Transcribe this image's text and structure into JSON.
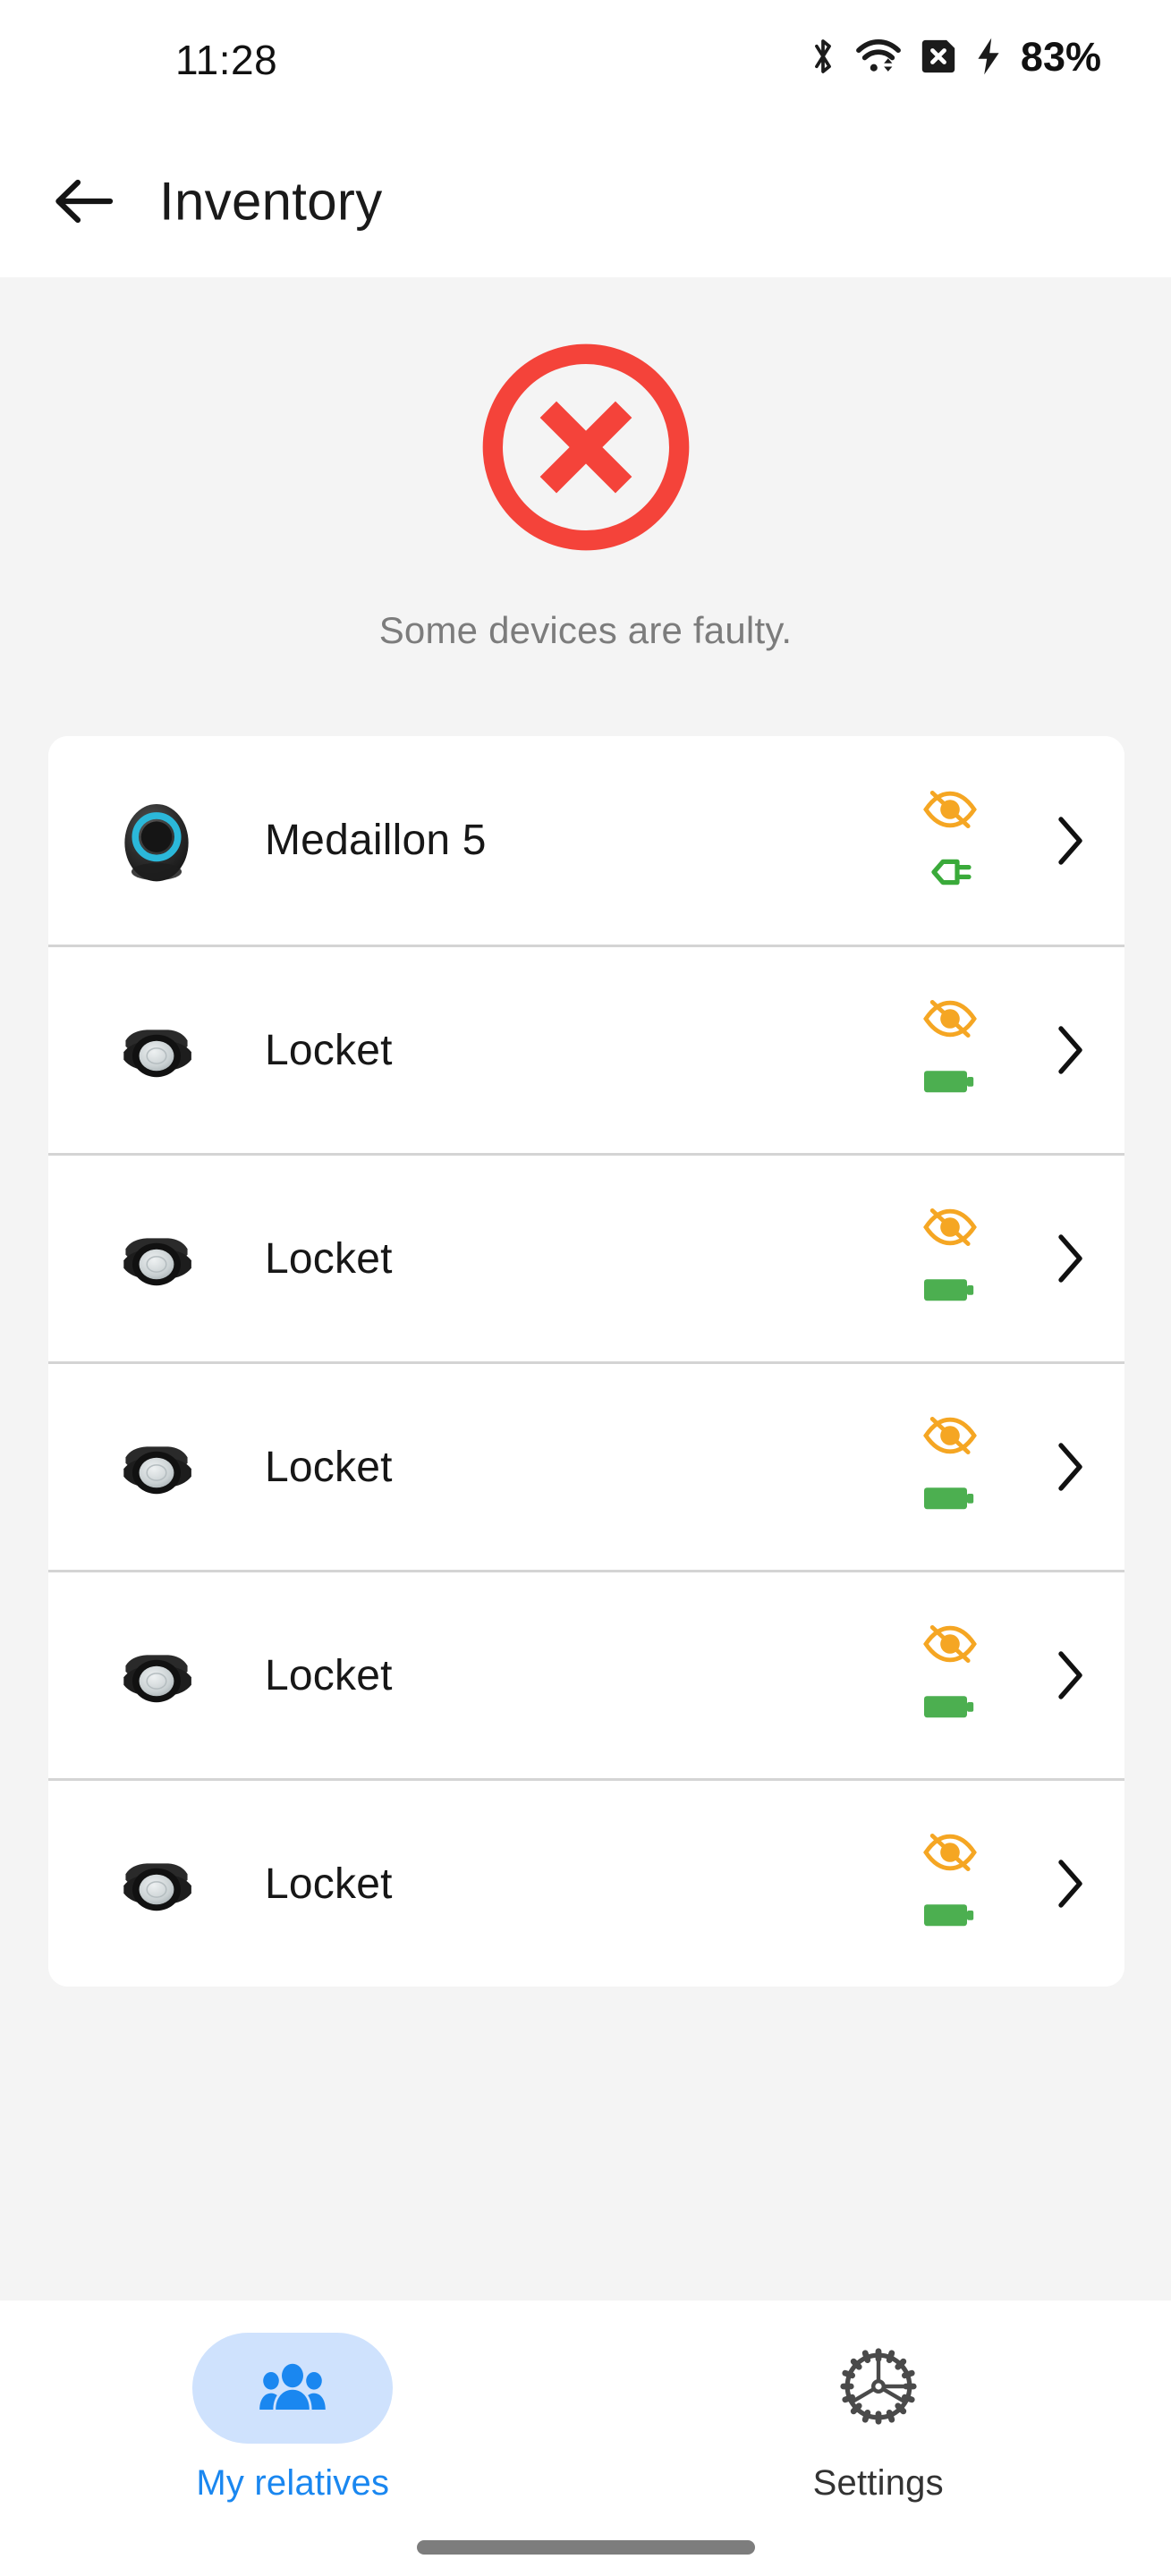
{
  "statusbar": {
    "time": "11:28",
    "battery_percent": "83%",
    "icons": [
      "bluetooth-icon",
      "wifi-icon",
      "sim-card-off-icon",
      "charging-bolt-icon"
    ]
  },
  "appbar": {
    "back_label": "back-arrow-icon",
    "title": "Inventory"
  },
  "status": {
    "icon": "error-circle-x-icon",
    "icon_color": "#F44336",
    "message": "Some devices are faulty."
  },
  "devices": [
    {
      "name": "Medaillon 5",
      "thumb": "medaillon-device-icon",
      "visibility": "visibility-off-icon",
      "visibility_color": "#F5A623",
      "power": "power-plug-icon",
      "power_color": "#3AAA3A",
      "chevron": "chevron-right-icon"
    },
    {
      "name": "Locket",
      "thumb": "locket-device-icon",
      "visibility": "visibility-off-icon",
      "visibility_color": "#F5A623",
      "power": "battery-full-icon",
      "power_color": "#4CAF50",
      "chevron": "chevron-right-icon"
    },
    {
      "name": "Locket",
      "thumb": "locket-device-icon",
      "visibility": "visibility-off-icon",
      "visibility_color": "#F5A623",
      "power": "battery-full-icon",
      "power_color": "#4CAF50",
      "chevron": "chevron-right-icon"
    },
    {
      "name": "Locket",
      "thumb": "locket-device-icon",
      "visibility": "visibility-off-icon",
      "visibility_color": "#F5A623",
      "power": "battery-full-icon",
      "power_color": "#4CAF50",
      "chevron": "chevron-right-icon"
    },
    {
      "name": "Locket",
      "thumb": "locket-device-icon",
      "visibility": "visibility-off-icon",
      "visibility_color": "#F5A623",
      "power": "battery-full-icon",
      "power_color": "#4CAF50",
      "chevron": "chevron-right-icon"
    },
    {
      "name": "Locket",
      "thumb": "locket-device-icon",
      "visibility": "visibility-off-icon",
      "visibility_color": "#F5A623",
      "power": "battery-full-icon",
      "power_color": "#4CAF50",
      "chevron": "chevron-right-icon"
    }
  ],
  "bottom_nav": {
    "items": [
      {
        "label": "My relatives",
        "icon": "people-group-icon",
        "active": true
      },
      {
        "label": "Settings",
        "icon": "gear-icon",
        "active": false
      }
    ],
    "active_color": "#1A87F0",
    "active_pill_color": "#CFE2FD"
  }
}
